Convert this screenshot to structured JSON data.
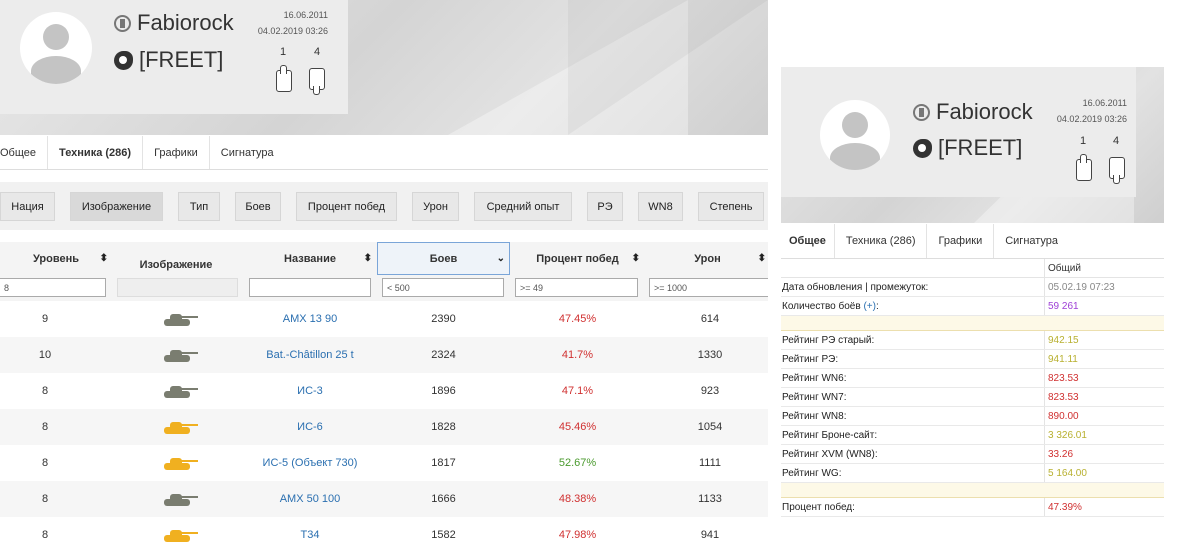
{
  "colors": {
    "red": "#d03030",
    "green": "#4a9a2e",
    "olive": "#b8b030",
    "purple": "#9e3fd6",
    "link": "#2a6fb0",
    "tank_grey": "#7a7d70",
    "tank_gold": "#f0b020"
  },
  "profile": {
    "name": "Fabiorock",
    "clan": "[FREET]",
    "date_created": "16.06.2011",
    "date_updated": "04.02.2019 03:26",
    "likes": "1",
    "dislikes": "4"
  },
  "tabs": [
    "Общее",
    "Техника (286)",
    "Графики",
    "Сигнатура"
  ],
  "filters": [
    "Нация",
    "Изображение",
    "Тип",
    "Боев",
    "Процент побед",
    "Урон",
    "Средний опыт",
    "РЭ",
    "WN8",
    "Степень"
  ],
  "vehicles_table": {
    "headers": [
      "Уровень",
      "Изображение",
      "Название",
      "Боев",
      "Процент побед",
      "Урон"
    ],
    "filters": [
      "8",
      "",
      "",
      "< 500",
      ">= 49",
      ">= 1000"
    ],
    "rows": [
      {
        "level": "9",
        "name": "AMX 13 90",
        "battles": "2390",
        "winrate": "47.45%",
        "damage": "614",
        "tank": "grey",
        "wr_color": "red"
      },
      {
        "level": "10",
        "name": "Bat.-Châtillon 25 t",
        "battles": "2324",
        "winrate": "41.7%",
        "damage": "1330",
        "tank": "grey",
        "wr_color": "red"
      },
      {
        "level": "8",
        "name": "ИС-3",
        "battles": "1896",
        "winrate": "47.1%",
        "damage": "923",
        "tank": "grey",
        "wr_color": "red"
      },
      {
        "level": "8",
        "name": "ИС-6",
        "battles": "1828",
        "winrate": "45.46%",
        "damage": "1054",
        "tank": "gold",
        "wr_color": "red"
      },
      {
        "level": "8",
        "name": "ИС-5 (Объект 730)",
        "battles": "1817",
        "winrate": "52.67%",
        "damage": "1111",
        "tank": "gold",
        "wr_color": "green"
      },
      {
        "level": "8",
        "name": "AMX 50 100",
        "battles": "1666",
        "winrate": "48.38%",
        "damage": "1133",
        "tank": "grey",
        "wr_color": "red"
      },
      {
        "level": "8",
        "name": "T34",
        "battles": "1582",
        "winrate": "47.98%",
        "damage": "941",
        "tank": "gold",
        "wr_color": "red"
      }
    ]
  },
  "right_panel": {
    "profile": {
      "name": "Fabiorock",
      "clan": "[FREET]",
      "date_created": "16.06.2011",
      "date_updated": "04.02.2019 03:26",
      "likes": "1",
      "dislikes": "4"
    },
    "tabs": [
      "Общее",
      "Техника (286)",
      "Графики",
      "Сигнатура"
    ],
    "column_header": "Общий",
    "stats": [
      {
        "label": "Дата обновления | промежуток:",
        "value": "05.02.19 07:23",
        "color": "#888888"
      },
      {
        "label": "Количество боёв",
        "plus": "(+)",
        "suffix": ":",
        "value": "59 261",
        "color": "#9e3fd6"
      },
      {
        "label": "",
        "value": "",
        "highlight": true
      },
      {
        "label": "Рейтинг РЭ старый:",
        "value": "942.15",
        "color": "#b8b030"
      },
      {
        "label": "Рейтинг РЭ:",
        "value": "941.11",
        "color": "#b8b030"
      },
      {
        "label": "Рейтинг WN6:",
        "value": "823.53",
        "color": "#d03030"
      },
      {
        "label": "Рейтинг WN7:",
        "value": "823.53",
        "color": "#d03030"
      },
      {
        "label": "Рейтинг WN8:",
        "value": "890.00",
        "color": "#d03030"
      },
      {
        "label": "Рейтинг Броне-сайт:",
        "value": "3 326.01",
        "color": "#b8b030"
      },
      {
        "label": "Рейтинг XVM (WN8):",
        "value": "33.26",
        "color": "#d03030"
      },
      {
        "label": "Рейтинг WG:",
        "value": "5 164.00",
        "color": "#b8b030"
      },
      {
        "label": "",
        "value": "",
        "highlight": true
      },
      {
        "label": "Процент побед:",
        "value": "47.39%",
        "color": "#d03030"
      }
    ]
  }
}
